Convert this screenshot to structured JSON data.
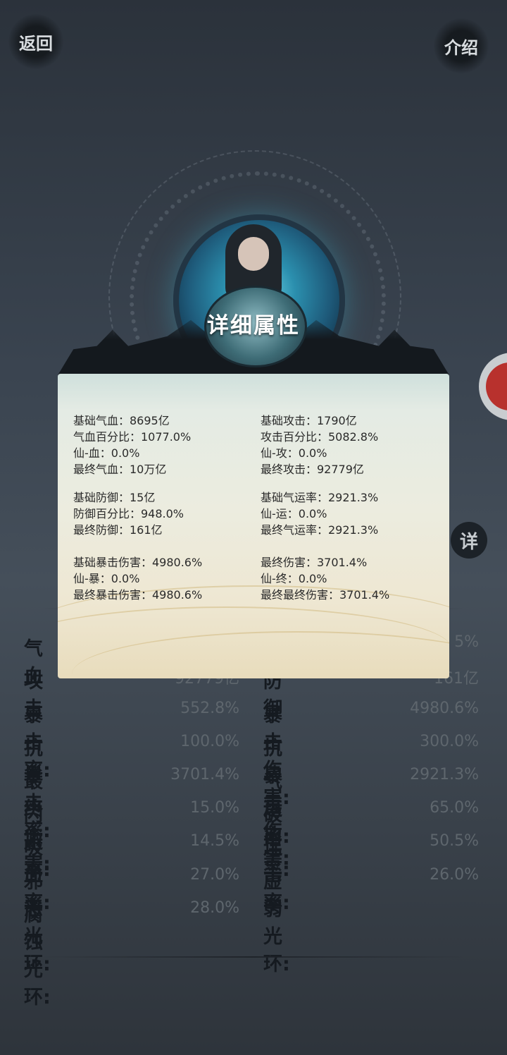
{
  "nav": {
    "back_label": "返回",
    "intro_label": "介绍",
    "detail_badge": "详"
  },
  "panel": {
    "title": "详细属性",
    "left_column": [
      [
        "基础气血：8695亿",
        "气血百分比：1077.0%",
        "仙-血：0.0%",
        "最终气血：10万亿"
      ],
      [
        "基础防御：15亿",
        "防御百分比：948.0%",
        "最终防御：161亿"
      ],
      [
        "基础暴击伤害：4980.6%",
        "仙-暴：0.0%",
        "最终暴击伤害：4980.6%"
      ]
    ],
    "right_column": [
      [
        "基础攻击：1790亿",
        "攻击百分比：5082.8%",
        "仙-攻：0.0%",
        "最终攻击：92779亿"
      ],
      [
        "基础气运率：2921.3%",
        "仙-运：0.0%",
        "最终气运率：2921.3%"
      ],
      [
        "最终伤害：3701.4%",
        "仙-终：0.0%",
        "最终最终伤害：3701.4%"
      ]
    ]
  },
  "stats": [
    {
      "label": "气血",
      "value": "",
      "label2": "",
      "value2": "5%"
    },
    {
      "label": "攻击",
      "value": "92779亿",
      "label2": "防御",
      "value2": "161亿"
    },
    {
      "label": "暴击率:",
      "value": "552.8%",
      "label2": "暴击伤害:",
      "value2": "4980.6%"
    },
    {
      "label": "抗暴击率:",
      "value": "100.0%",
      "label2": "抗暴击伤害:",
      "value2": "300.0%"
    },
    {
      "label": "最终伤害:",
      "value": "3701.4%",
      "label2": "气运率:",
      "value2": "2921.3%"
    },
    {
      "label": "闪避率:",
      "value": "15.0%",
      "label2": "破甲率:",
      "value2": "65.0%"
    },
    {
      "label": "吸血率:",
      "value": "14.5%",
      "label2": "连击率:",
      "value2": "50.5%"
    },
    {
      "label": "邪恶光环:",
      "value": "27.0%",
      "label2": "虚弱光环:",
      "value2": "26.0%"
    },
    {
      "label": "腐蚀光环:",
      "value": "28.0%",
      "label2": "",
      "value2": ""
    }
  ]
}
